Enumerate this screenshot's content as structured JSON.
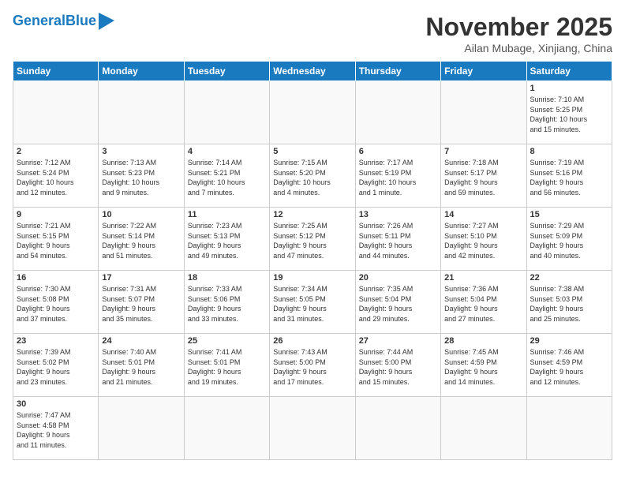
{
  "header": {
    "logo_general": "General",
    "logo_blue": "Blue",
    "month": "November 2025",
    "location": "Ailan Mubage, Xinjiang, China"
  },
  "days_of_week": [
    "Sunday",
    "Monday",
    "Tuesday",
    "Wednesday",
    "Thursday",
    "Friday",
    "Saturday"
  ],
  "weeks": [
    [
      {
        "day": "",
        "info": ""
      },
      {
        "day": "",
        "info": ""
      },
      {
        "day": "",
        "info": ""
      },
      {
        "day": "",
        "info": ""
      },
      {
        "day": "",
        "info": ""
      },
      {
        "day": "",
        "info": ""
      },
      {
        "day": "1",
        "info": "Sunrise: 7:10 AM\nSunset: 5:25 PM\nDaylight: 10 hours\nand 15 minutes."
      }
    ],
    [
      {
        "day": "2",
        "info": "Sunrise: 7:12 AM\nSunset: 5:24 PM\nDaylight: 10 hours\nand 12 minutes."
      },
      {
        "day": "3",
        "info": "Sunrise: 7:13 AM\nSunset: 5:23 PM\nDaylight: 10 hours\nand 9 minutes."
      },
      {
        "day": "4",
        "info": "Sunrise: 7:14 AM\nSunset: 5:21 PM\nDaylight: 10 hours\nand 7 minutes."
      },
      {
        "day": "5",
        "info": "Sunrise: 7:15 AM\nSunset: 5:20 PM\nDaylight: 10 hours\nand 4 minutes."
      },
      {
        "day": "6",
        "info": "Sunrise: 7:17 AM\nSunset: 5:19 PM\nDaylight: 10 hours\nand 1 minute."
      },
      {
        "day": "7",
        "info": "Sunrise: 7:18 AM\nSunset: 5:17 PM\nDaylight: 9 hours\nand 59 minutes."
      },
      {
        "day": "8",
        "info": "Sunrise: 7:19 AM\nSunset: 5:16 PM\nDaylight: 9 hours\nand 56 minutes."
      }
    ],
    [
      {
        "day": "9",
        "info": "Sunrise: 7:21 AM\nSunset: 5:15 PM\nDaylight: 9 hours\nand 54 minutes."
      },
      {
        "day": "10",
        "info": "Sunrise: 7:22 AM\nSunset: 5:14 PM\nDaylight: 9 hours\nand 51 minutes."
      },
      {
        "day": "11",
        "info": "Sunrise: 7:23 AM\nSunset: 5:13 PM\nDaylight: 9 hours\nand 49 minutes."
      },
      {
        "day": "12",
        "info": "Sunrise: 7:25 AM\nSunset: 5:12 PM\nDaylight: 9 hours\nand 47 minutes."
      },
      {
        "day": "13",
        "info": "Sunrise: 7:26 AM\nSunset: 5:11 PM\nDaylight: 9 hours\nand 44 minutes."
      },
      {
        "day": "14",
        "info": "Sunrise: 7:27 AM\nSunset: 5:10 PM\nDaylight: 9 hours\nand 42 minutes."
      },
      {
        "day": "15",
        "info": "Sunrise: 7:29 AM\nSunset: 5:09 PM\nDaylight: 9 hours\nand 40 minutes."
      }
    ],
    [
      {
        "day": "16",
        "info": "Sunrise: 7:30 AM\nSunset: 5:08 PM\nDaylight: 9 hours\nand 37 minutes."
      },
      {
        "day": "17",
        "info": "Sunrise: 7:31 AM\nSunset: 5:07 PM\nDaylight: 9 hours\nand 35 minutes."
      },
      {
        "day": "18",
        "info": "Sunrise: 7:33 AM\nSunset: 5:06 PM\nDaylight: 9 hours\nand 33 minutes."
      },
      {
        "day": "19",
        "info": "Sunrise: 7:34 AM\nSunset: 5:05 PM\nDaylight: 9 hours\nand 31 minutes."
      },
      {
        "day": "20",
        "info": "Sunrise: 7:35 AM\nSunset: 5:04 PM\nDaylight: 9 hours\nand 29 minutes."
      },
      {
        "day": "21",
        "info": "Sunrise: 7:36 AM\nSunset: 5:04 PM\nDaylight: 9 hours\nand 27 minutes."
      },
      {
        "day": "22",
        "info": "Sunrise: 7:38 AM\nSunset: 5:03 PM\nDaylight: 9 hours\nand 25 minutes."
      }
    ],
    [
      {
        "day": "23",
        "info": "Sunrise: 7:39 AM\nSunset: 5:02 PM\nDaylight: 9 hours\nand 23 minutes."
      },
      {
        "day": "24",
        "info": "Sunrise: 7:40 AM\nSunset: 5:01 PM\nDaylight: 9 hours\nand 21 minutes."
      },
      {
        "day": "25",
        "info": "Sunrise: 7:41 AM\nSunset: 5:01 PM\nDaylight: 9 hours\nand 19 minutes."
      },
      {
        "day": "26",
        "info": "Sunrise: 7:43 AM\nSunset: 5:00 PM\nDaylight: 9 hours\nand 17 minutes."
      },
      {
        "day": "27",
        "info": "Sunrise: 7:44 AM\nSunset: 5:00 PM\nDaylight: 9 hours\nand 15 minutes."
      },
      {
        "day": "28",
        "info": "Sunrise: 7:45 AM\nSunset: 4:59 PM\nDaylight: 9 hours\nand 14 minutes."
      },
      {
        "day": "29",
        "info": "Sunrise: 7:46 AM\nSunset: 4:59 PM\nDaylight: 9 hours\nand 12 minutes."
      }
    ],
    [
      {
        "day": "30",
        "info": "Sunrise: 7:47 AM\nSunset: 4:58 PM\nDaylight: 9 hours\nand 11 minutes."
      },
      {
        "day": "",
        "info": ""
      },
      {
        "day": "",
        "info": ""
      },
      {
        "day": "",
        "info": ""
      },
      {
        "day": "",
        "info": ""
      },
      {
        "day": "",
        "info": ""
      },
      {
        "day": "",
        "info": ""
      }
    ]
  ]
}
